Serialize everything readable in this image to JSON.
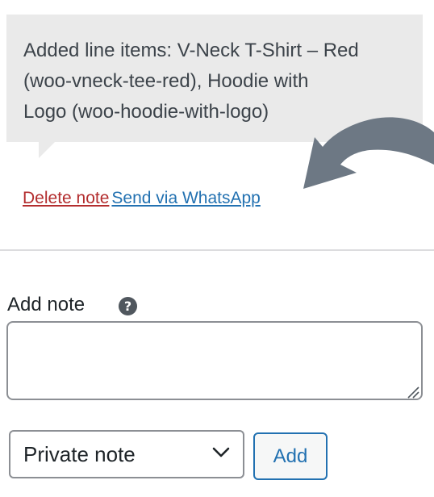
{
  "note": {
    "line1": "Added line items: V-Neck T-Shirt – Red",
    "line2": "(woo-vneck-tee-red), Hoodie with",
    "line3": "Logo (woo-hoodie-with-logo)",
    "delete_label": "Delete note",
    "whatsapp_label": "Send via WhatsApp"
  },
  "add_note": {
    "label": "Add note",
    "help_glyph": "?",
    "textarea_value": "",
    "note_type_selected": "Private note",
    "add_button_label": "Add"
  },
  "icons": {
    "arrow": "curved-arrow-icon",
    "help": "help-icon",
    "select": "chevron-down-icon",
    "resize": "resize-handle-icon"
  },
  "colors": {
    "bubble_bg": "#eaeaea",
    "delete_link": "#b32d2e",
    "wp_blue": "#2271b1",
    "arrow": "#6d7884"
  }
}
